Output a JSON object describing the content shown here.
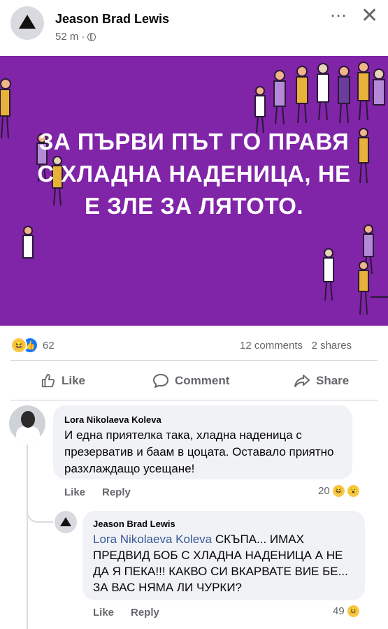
{
  "post": {
    "author": "Jeason Brad Lewis",
    "time": "52 m",
    "separator": "·",
    "more_icon": "⋯",
    "close_icon": "✕"
  },
  "banner": {
    "background": "#8024a8",
    "text": "ЗА ПЪРВИ ПЪТ ГО ПРАВЯ С ХЛАДНА НАДЕНИЦА, НЕ Е ЗЛЕ ЗА ЛЯТОТО."
  },
  "stats": {
    "reaction_count": "62",
    "comments": "12 comments",
    "shares": "2 shares"
  },
  "actions": {
    "like": "Like",
    "comment": "Comment",
    "share": "Share"
  },
  "comments": [
    {
      "name": "Lora Nikolaeva Koleva",
      "text": "И една приятелка така, хладна наденица с презерватив и баам в цоцата. Оставало приятно разхлаждащо усещане!",
      "like": "Like",
      "reply": "Reply",
      "reaction_count": "20"
    },
    {
      "name": "Jeason Brad Lewis",
      "mention": "Lora Nikolaeva Koleva",
      "text": " СКЪПА... ИМАХ ПРЕДВИД БОБ С ХЛАДНА НАДЕНИЦА А НЕ ДА Я ПЕКА!!! КАКВО СИ ВКАРВАТЕ ВИЕ БЕ... ЗА ВАС НЯМА ЛИ ЧУРКИ?",
      "like": "Like",
      "reply": "Reply",
      "reaction_count": "49"
    }
  ],
  "colors": {
    "accent": "#1877f2",
    "secondary_text": "#65676b",
    "bubble": "#f0f2f5"
  }
}
